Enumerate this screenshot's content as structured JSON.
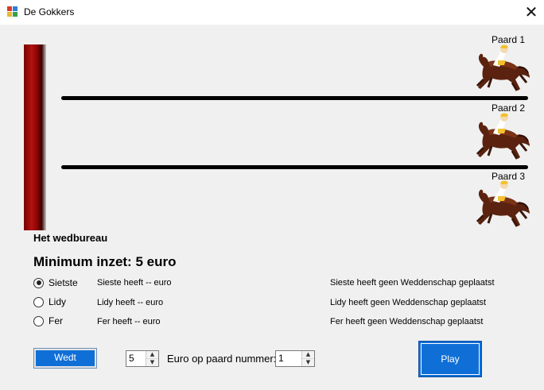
{
  "window": {
    "title": "De Gokkers",
    "close_glyph": "✕",
    "app_icon": "form-icon"
  },
  "track": {
    "horses": [
      {
        "label": "Paard 1",
        "icon": "racehorse-icon"
      },
      {
        "label": "Paard 2",
        "icon": "racehorse-icon"
      },
      {
        "label": "Paard 3",
        "icon": "racehorse-icon"
      }
    ]
  },
  "bureau": {
    "heading": "Het wedbureau",
    "minimum": "Minimum inzet: 5 euro",
    "bettors": [
      {
        "name": "Sietste",
        "selected": true,
        "bet": "Sieste heeft  -- euro",
        "status": "Sieste heeft geen Weddenschap geplaatst"
      },
      {
        "name": "Lidy",
        "selected": false,
        "bet": "Lidy heeft  -- euro",
        "status": "Lidy heeft geen Weddenschap geplaatst"
      },
      {
        "name": "Fer",
        "selected": false,
        "bet": "Fer heeft -- euro",
        "status": "Fer heeft geen Weddenschap geplaatst"
      }
    ]
  },
  "controls": {
    "bet_button": "Wedt",
    "amount": "5",
    "amount_label": "Euro op paard nummer:",
    "horse_number": "1",
    "play_button": "Play"
  }
}
